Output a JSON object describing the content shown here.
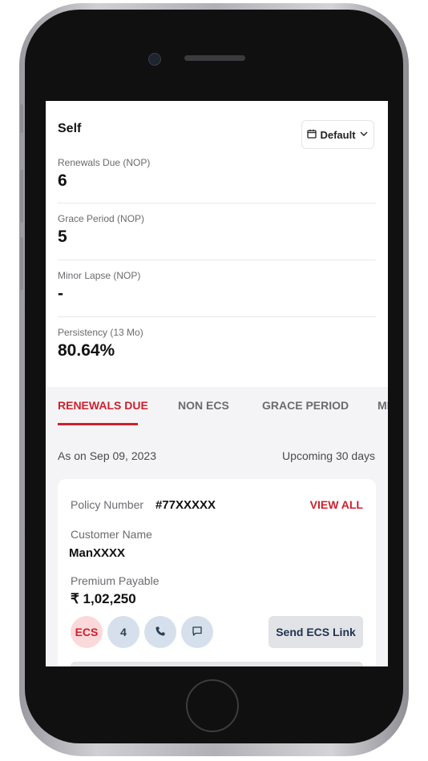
{
  "summary": {
    "title": "Self",
    "period_label": "Default",
    "metrics": [
      {
        "label": "Renewals Due (NOP)",
        "value": "6"
      },
      {
        "label": "Grace Period (NOP)",
        "value": "5"
      },
      {
        "label": "Minor Lapse (NOP)",
        "value": "-"
      },
      {
        "label": "Persistency (13 Mo)",
        "value": "80.64%"
      }
    ]
  },
  "tabs": [
    {
      "label": "RENEWALS DUE",
      "active": true
    },
    {
      "label": "NON ECS",
      "active": false
    },
    {
      "label": "GRACE PERIOD",
      "active": false
    },
    {
      "label": "MI",
      "active": false
    }
  ],
  "list": {
    "as_on": "As on Sep 09, 2023",
    "range": "Upcoming 30 days",
    "card": {
      "policy_label": "Policy Number",
      "policy_number": "#77XXXXX",
      "view_all": "VIEW ALL",
      "customer_label": "Customer Name",
      "customer_name": "ManXXXX",
      "premium_label": "Premium Payable",
      "premium_value": "₹ 1,02,250",
      "ecs_chip": "ECS",
      "count_chip": "4",
      "send_button": "Send ECS Link"
    }
  },
  "colors": {
    "accent": "#d01f2d",
    "chip_bg": "#d5e0ec",
    "tabs_bg": "#f4f4f6"
  },
  "icons": [
    "calendar-icon",
    "chevron-down-icon",
    "phone-icon",
    "message-icon"
  ]
}
